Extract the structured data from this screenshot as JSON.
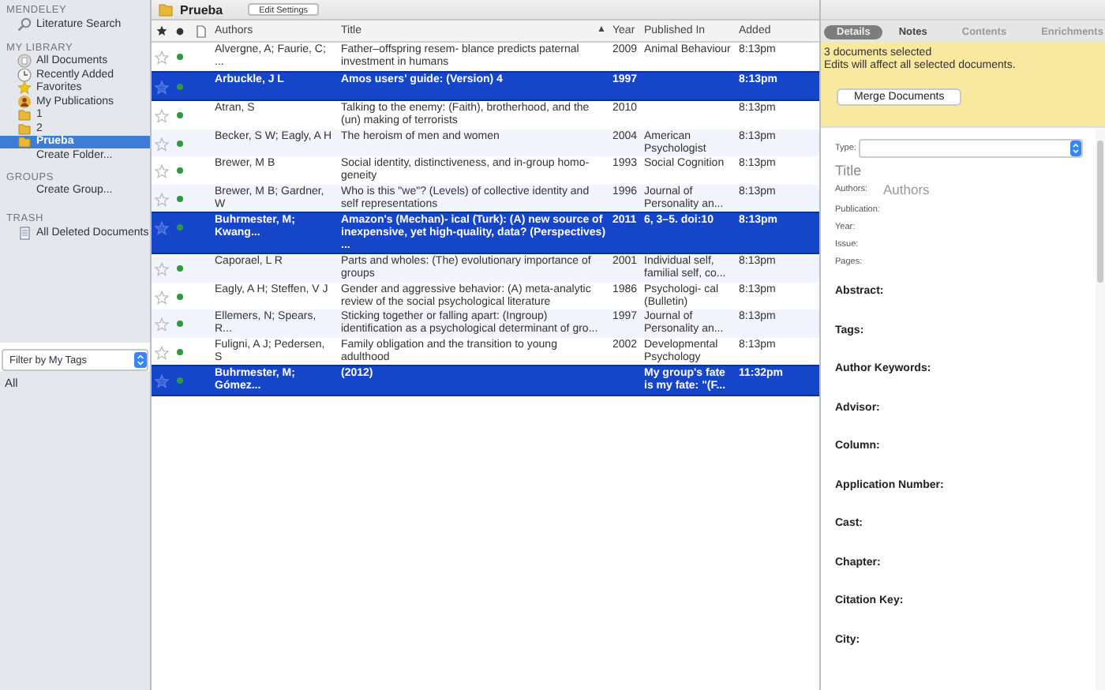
{
  "sidebar": {
    "sections": [
      {
        "heading": "MENDELEY",
        "items": [
          {
            "label": "Literature Search",
            "kind": "search",
            "selected": false
          }
        ]
      },
      {
        "heading": "MY LIBRARY",
        "items": [
          {
            "label": "All Documents",
            "kind": "documents",
            "selected": false
          },
          {
            "label": "Recently Added",
            "kind": "recent",
            "selected": false
          },
          {
            "label": "Favorites",
            "kind": "favorites",
            "selected": false
          },
          {
            "label": "My Publications",
            "kind": "publications",
            "selected": false
          },
          {
            "label": "1",
            "kind": "folder",
            "selected": false
          },
          {
            "label": "2",
            "kind": "folder",
            "selected": false
          },
          {
            "label": "Prueba",
            "kind": "folder",
            "selected": true
          },
          {
            "label": "Create Folder...",
            "kind": "action",
            "selected": false
          }
        ]
      },
      {
        "heading": "GROUPS",
        "items": [
          {
            "label": "Create Group...",
            "kind": "action",
            "selected": false
          }
        ]
      },
      {
        "heading": "TRASH",
        "items": [
          {
            "label": "All Deleted Documents",
            "kind": "trash",
            "selected": false
          }
        ]
      }
    ],
    "filter": {
      "value": "Filter by My Tags"
    },
    "tag_list": [
      "All"
    ]
  },
  "folder": {
    "title": "Prueba",
    "button": "Edit Settings"
  },
  "table": {
    "columns": [
      {
        "kind": "star"
      },
      {
        "kind": "read"
      },
      {
        "kind": "file"
      },
      {
        "kind": "text",
        "label": "Authors"
      },
      {
        "kind": "text",
        "label": "Title",
        "sort": "▲"
      },
      {
        "kind": "text",
        "label": "Year"
      },
      {
        "kind": "text",
        "label": "Published In"
      },
      {
        "kind": "text",
        "label": "Added"
      }
    ],
    "rows": [
      {
        "starred": false,
        "unread": true,
        "selected": false,
        "authors": "Alvergne, A; Faurie, C; ...",
        "title": "Father–offspring resem- blance predicts paternal investment in humans",
        "year": "2009",
        "published_in": "Animal Behaviour",
        "added": "8:13pm"
      },
      {
        "starred": false,
        "unread": true,
        "selected": true,
        "authors": "Arbuckle, J L",
        "title": "Amos users' guide: (Version) 4",
        "year": "1997",
        "published_in": "",
        "added": "8:13pm"
      },
      {
        "starred": false,
        "unread": true,
        "selected": false,
        "authors": "Atran, S",
        "title": "Talking to the enemy: (Faith), brotherhood, and the (un) making of terrorists",
        "year": "2010",
        "published_in": "",
        "added": "8:13pm"
      },
      {
        "starred": false,
        "unread": true,
        "selected": false,
        "authors": "Becker, S W; Eagly, A H",
        "title": "The heroism of men and women",
        "year": "2004",
        "published_in": "American Psychologist",
        "added": "8:13pm"
      },
      {
        "starred": false,
        "unread": true,
        "selected": false,
        "authors": "Brewer, M B",
        "title": "Social identity, distinctiveness, and in-group homo- geneity",
        "year": "1993",
        "published_in": "Social Cognition",
        "added": "8:13pm"
      },
      {
        "starred": false,
        "unread": true,
        "selected": false,
        "authors": "Brewer, M B; Gardner, W",
        "title": "Who is this \"we\"? (Levels) of collective identity and self representations",
        "year": "1996",
        "published_in": "Journal of Personality an...",
        "added": "8:13pm"
      },
      {
        "starred": false,
        "unread": true,
        "selected": true,
        "authors": "Buhrmester, M; Kwang...",
        "title": "Amazon's (Mechan)- ical (Turk): (A) new source of inexpensive, yet high-quality, data? (Perspectives) ...",
        "year": "2011",
        "published_in": "6, 3–5. doi:10",
        "added": "8:13pm"
      },
      {
        "starred": false,
        "unread": true,
        "selected": false,
        "authors": "Caporael, L R",
        "title": "Parts and wholes: (The) evolutionary importance of groups",
        "year": "2001",
        "published_in": "Individual self, familial self, co...",
        "added": "8:13pm"
      },
      {
        "starred": false,
        "unread": true,
        "selected": false,
        "authors": "Eagly, A H; Steffen, V J",
        "title": "Gender and aggressive behavior: (A) meta-analytic review of the social psychological literature",
        "year": "1986",
        "published_in": "Psychologi- cal (Bulletin)",
        "added": "8:13pm"
      },
      {
        "starred": false,
        "unread": true,
        "selected": false,
        "authors": "Ellemers, N; Spears, R...",
        "title": "Sticking together or falling apart: (Ingroup) identification as a psychological determinant of gro...",
        "year": "1997",
        "published_in": "Journal of Personality an...",
        "added": "8:13pm"
      },
      {
        "starred": false,
        "unread": true,
        "selected": false,
        "authors": "Fuligni, A J; Pedersen, S",
        "title": "Family obligation and the transition to young adulthood",
        "year": "2002",
        "published_in": "Developmental Psychology",
        "added": "8:13pm"
      },
      {
        "starred": false,
        "unread": true,
        "selected": true,
        "authors": "Buhrmester, M; Gómez...",
        "title": "(2012)",
        "year": "",
        "published_in": "My group's fate is my fate: \"(F...",
        "added": "11:32pm"
      }
    ]
  },
  "details": {
    "tabs": [
      {
        "label": "Details",
        "selected": true
      },
      {
        "label": "Notes",
        "selected": false
      },
      {
        "label": "Contents",
        "selected": false
      },
      {
        "label": "Enrichments",
        "selected": false
      }
    ],
    "notice": {
      "title": "3 documents selected",
      "message": "Edits will affect all selected documents.",
      "button": "Merge Documents"
    },
    "type_label": "Type:",
    "title_placeholder": "Title",
    "authors_label": "Authors:",
    "authors_placeholder": "Authors",
    "small_fields": [
      "Publication:",
      "Year:",
      "Issue:",
      "Pages:"
    ],
    "sections": [
      "Abstract:",
      "Tags:",
      "Author Keywords:",
      "Advisor:",
      "Column:",
      "Application Number:",
      "Cast:",
      "Chapter:",
      "Citation Key:",
      "City:"
    ]
  }
}
